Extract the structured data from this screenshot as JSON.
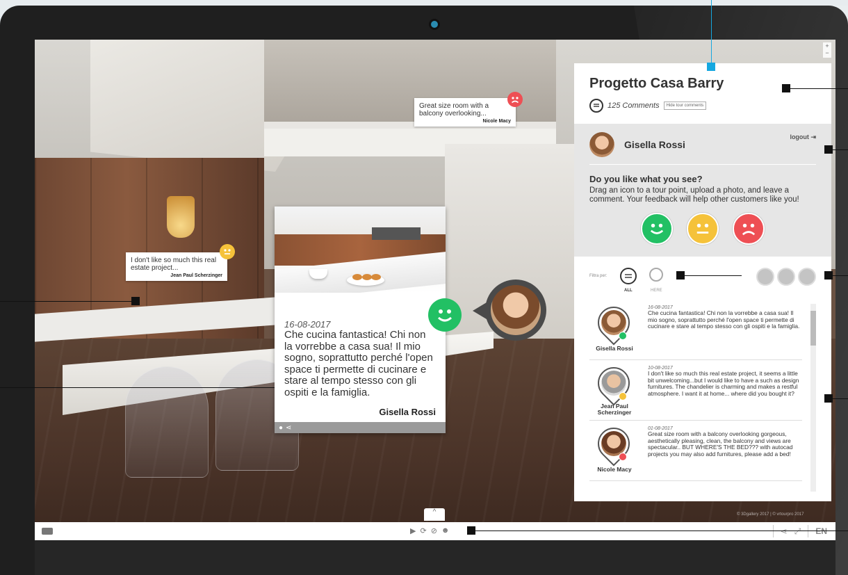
{
  "panel": {
    "title": "Progetto Casa Barry",
    "comments_count": "125 Comments",
    "hide_button": "Hide tour comments",
    "user_name": "Gisella Rossi",
    "logout": "logout",
    "question_title": "Do you like what you see?",
    "question_body": "Drag an icon to a tour point, upload a photo, and leave a comment. Your feedback will help other customers like you!",
    "filter_label": "Filtra per:",
    "filter_all": "ALL",
    "filter_here": "HERE"
  },
  "list": [
    {
      "name": "Gisella Rossi",
      "date": "16-08-2017",
      "text": "Che cucina fantastica! Chi non la vorrebbe a casa sua! Il mio sogno, soprattutto perché l'open space ti permette di cucinare e stare al tempo stesso con gli ospiti e la famiglia.",
      "mood": "happy"
    },
    {
      "name": "Jean Paul Scherzinger",
      "date": "10-08-2017",
      "text": "I don't like so much this real estate project, it seems a little bit unwelcoming...but I would like to have a such as design furnitures. The chandelier is charming and makes a restful atmosphere. I want it at home... where did you bought it?",
      "mood": "neutral"
    },
    {
      "name": "Nicole Macy",
      "date": "01-08-2017",
      "text": "Great size room with a balcony overlooking gorgeous, aesthetically pleasing, clean, the balcony and views are spectacular.. BUT WHERE'S THE BED??? with autocad projects you may also add furnitures, please add a bed!",
      "mood": "sad"
    }
  ],
  "pins": {
    "top_text": "Great size room with a balcony overlooking...",
    "top_author": "Nicole Macy",
    "left_text": "I don't like so much this real estate project...",
    "left_author": "Jean Paul Scherzinger"
  },
  "card": {
    "date": "16-08-2017",
    "body": "Che cucina fantastica! Chi non la vorrebbe a casa sua! Il mio sogno, soprattutto perché l'open space ti permette di cucinare e stare al tempo stesso con gli ospiti e la famiglia.",
    "author": "Gisella Rossi"
  },
  "toolbar": {
    "lang": "EN",
    "copyright": "© 3Dgallery 2017 | © vrtourpro 2017"
  },
  "colors": {
    "happy": "#22c064",
    "neutral": "#f5c23a",
    "sad": "#ee4f54",
    "accent": "#16a8e0"
  },
  "icons": [
    "comment-icon",
    "logout-icon",
    "vr-headset-icon",
    "play-icon",
    "rotate-icon",
    "hide-icon",
    "mood-icon",
    "share-icon",
    "fullscreen-icon",
    "alert-icon",
    "location-pin-icon",
    "zoom-in-icon",
    "zoom-out-icon"
  ]
}
